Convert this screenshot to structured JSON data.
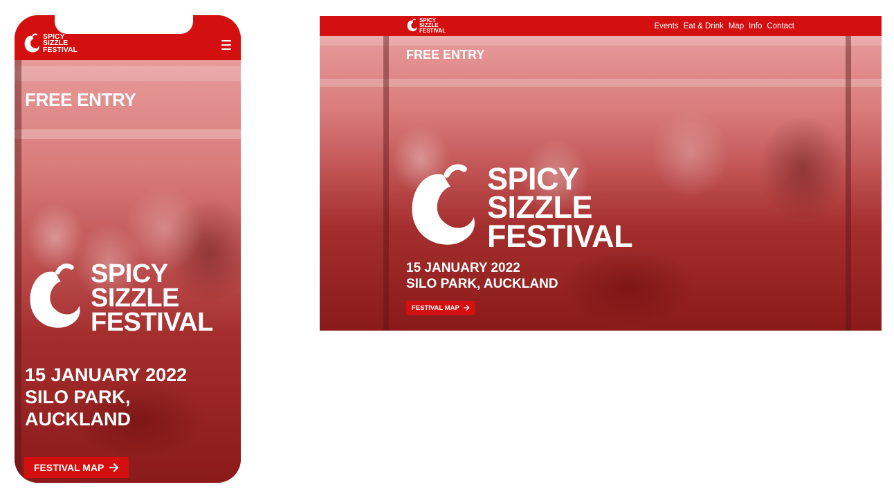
{
  "brand": {
    "line1": "SPICY",
    "line2": "SIZZLE",
    "line3": "FESTIVAL",
    "color": "#d40f0f"
  },
  "nav": {
    "items": [
      "Events",
      "Eat & Drink",
      "Map",
      "Info",
      "Contact"
    ],
    "menu_icon": "hamburger-icon"
  },
  "hero": {
    "free_entry": "FREE ENTRY",
    "date": "15 JANUARY 2022",
    "venue_desktop": "SILO PARK, AUCKLAND",
    "venue_mobile_line1": "SILO PARK,",
    "venue_mobile_line2": "AUCKLAND",
    "button_label": "FESTIVAL MAP",
    "button_icon": "arrow-right-icon"
  },
  "logo_icon": "chili-pepper-icon"
}
